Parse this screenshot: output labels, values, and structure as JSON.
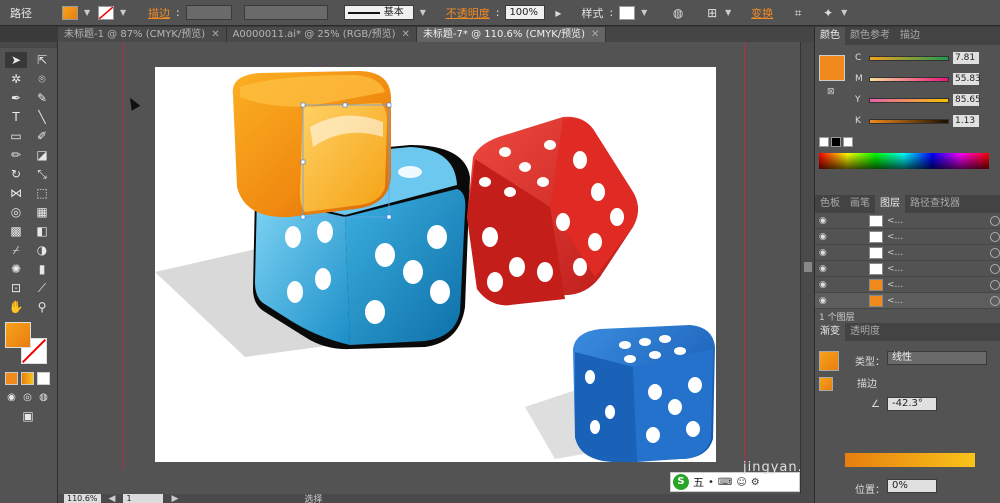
{
  "control_bar": {
    "object_type": "路径",
    "stroke_label": "描边",
    "stroke_style": "基本",
    "opacity_label": "不透明度",
    "opacity_value": "100%",
    "style_label": "样式",
    "transform_label": "变换"
  },
  "tabs": [
    {
      "label": "未标题-1 @ 87% (CMYK/预览)",
      "active": false
    },
    {
      "label": "A0000011.ai* @ 25% (RGB/预览)",
      "active": false
    },
    {
      "label": "未标题-7* @ 110.6% (CMYK/预览)",
      "active": true
    }
  ],
  "color_panel": {
    "tabs": [
      "颜色",
      "颜色参考",
      "描边"
    ],
    "channels": [
      {
        "name": "C",
        "value": "7.81"
      },
      {
        "name": "M",
        "value": "55.83"
      },
      {
        "name": "Y",
        "value": "85.65"
      },
      {
        "name": "K",
        "value": "1.13"
      }
    ]
  },
  "layers_panel": {
    "tabs": [
      "色板",
      "画笔",
      "图层",
      "路径查找器"
    ],
    "rows": [
      "<...",
      "<...",
      "<...",
      "<...",
      "<...",
      "<...",
      "<..."
    ],
    "footer": "1 个图层"
  },
  "gradient_panel": {
    "tabs": [
      "渐变",
      "透明度"
    ],
    "type_label": "类型：",
    "type_value": "线性",
    "stroke_label": "描边",
    "angle_value": "-42.3°",
    "position_label": "位置：",
    "position_value": "0%"
  },
  "status_bar": {
    "zoom": "110.6%",
    "page": "1",
    "mode": "选择"
  },
  "ime": {
    "label": "五"
  },
  "watermark": {
    "text": "jingyan.baidu.com"
  },
  "colors": {
    "fill": "#f08a1c",
    "accent_orange": "#f08a24",
    "guide": "#b03040"
  }
}
